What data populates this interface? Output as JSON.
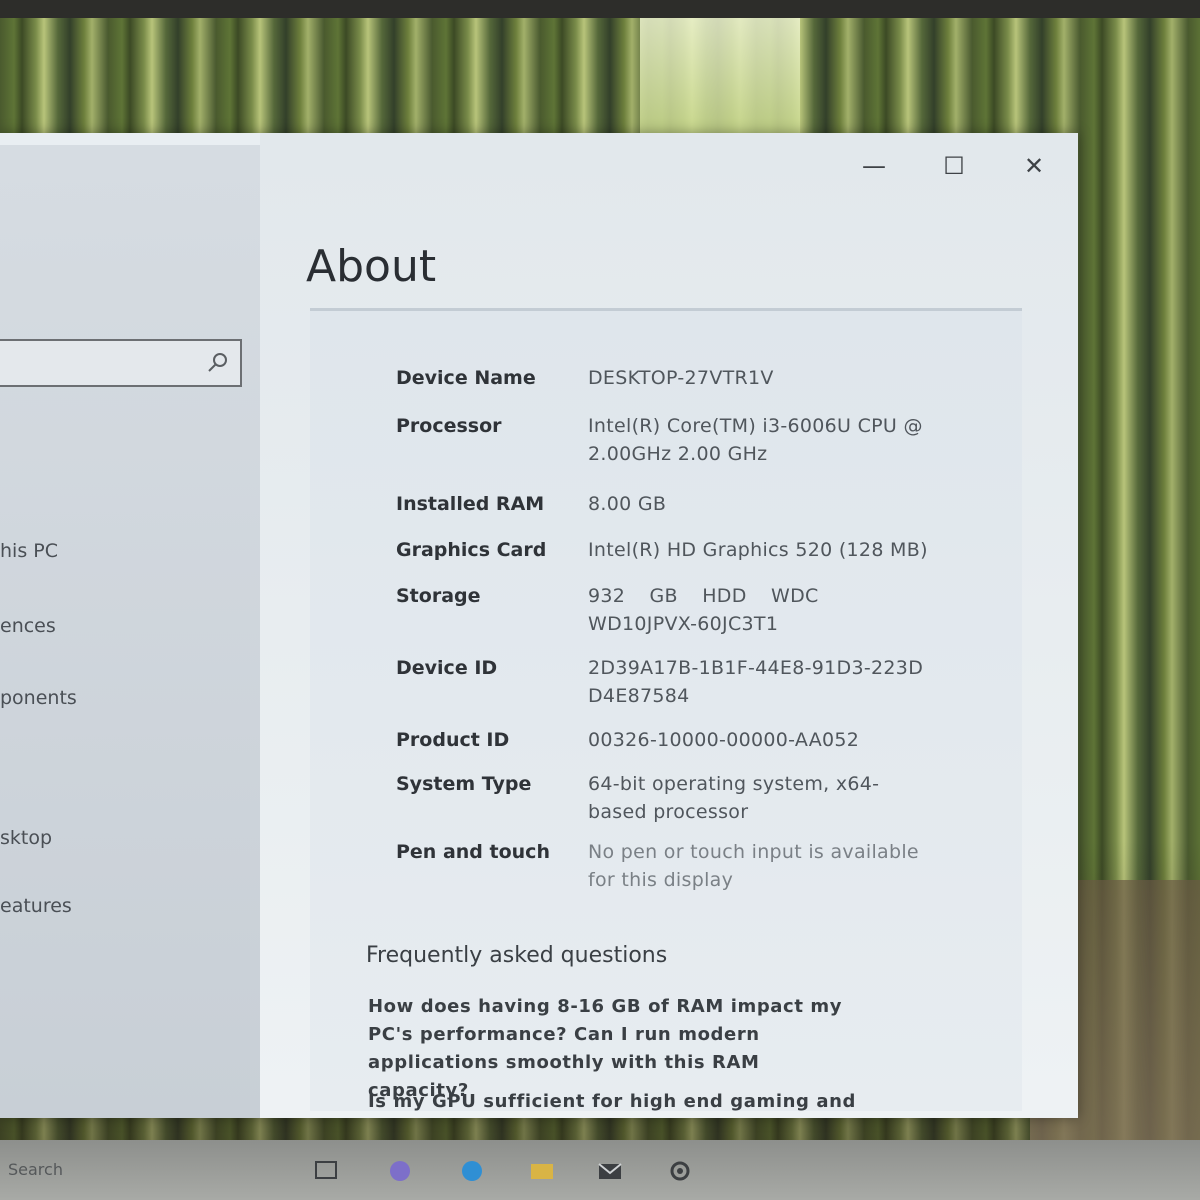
{
  "window": {
    "controls": {
      "minimize": "—",
      "maximize": "☐",
      "close": "✕"
    }
  },
  "sidebar": {
    "search": {
      "placeholder": ""
    },
    "items": [
      {
        "label": "his PC"
      },
      {
        "label": "ences"
      },
      {
        "label": "ponents"
      },
      {
        "label": "sktop"
      },
      {
        "label": "eatures"
      }
    ]
  },
  "main": {
    "title": "About",
    "specs": [
      {
        "label": "Device Name",
        "value": "DESKTOP-27VTR1V"
      },
      {
        "label": "Processor",
        "value": "Intel(R) Core(TM) i3-6006U CPU @ 2.00GHz 2.00 GHz"
      },
      {
        "label": "Installed RAM",
        "value": "8.00 GB"
      },
      {
        "label": "Graphics Card",
        "value": "Intel(R) HD Graphics 520 (128 MB)"
      },
      {
        "label": "Storage",
        "value": "932 GB HDD WDC WD10JPVX-60JC3T1"
      },
      {
        "label": "Device ID",
        "value": "2D39A17B-1B1F-44E8-91D3-223DD4E87584"
      },
      {
        "label": "Product ID",
        "value": "00326-10000-00000-AA052"
      },
      {
        "label": "System Type",
        "value": "64-bit operating system, x64-based processor"
      },
      {
        "label": "Pen and touch",
        "value": "No pen or touch input is available for this display"
      }
    ],
    "faq": {
      "heading": "Frequently asked questions",
      "questions": [
        {
          "text": "How does having 8-16 GB of RAM impact my PC's performance? Can I run modern applications smoothly with this RAM capacity?"
        },
        {
          "text": "Is my GPU sufficient for high end gaming and"
        }
      ]
    }
  },
  "taskbar": {
    "search_text": "Search"
  },
  "colors": {
    "window_bg": "#e9eef2",
    "sidebar_bg": "#d6dce2",
    "label_text": "#2f3338",
    "value_text": "#50565c"
  }
}
